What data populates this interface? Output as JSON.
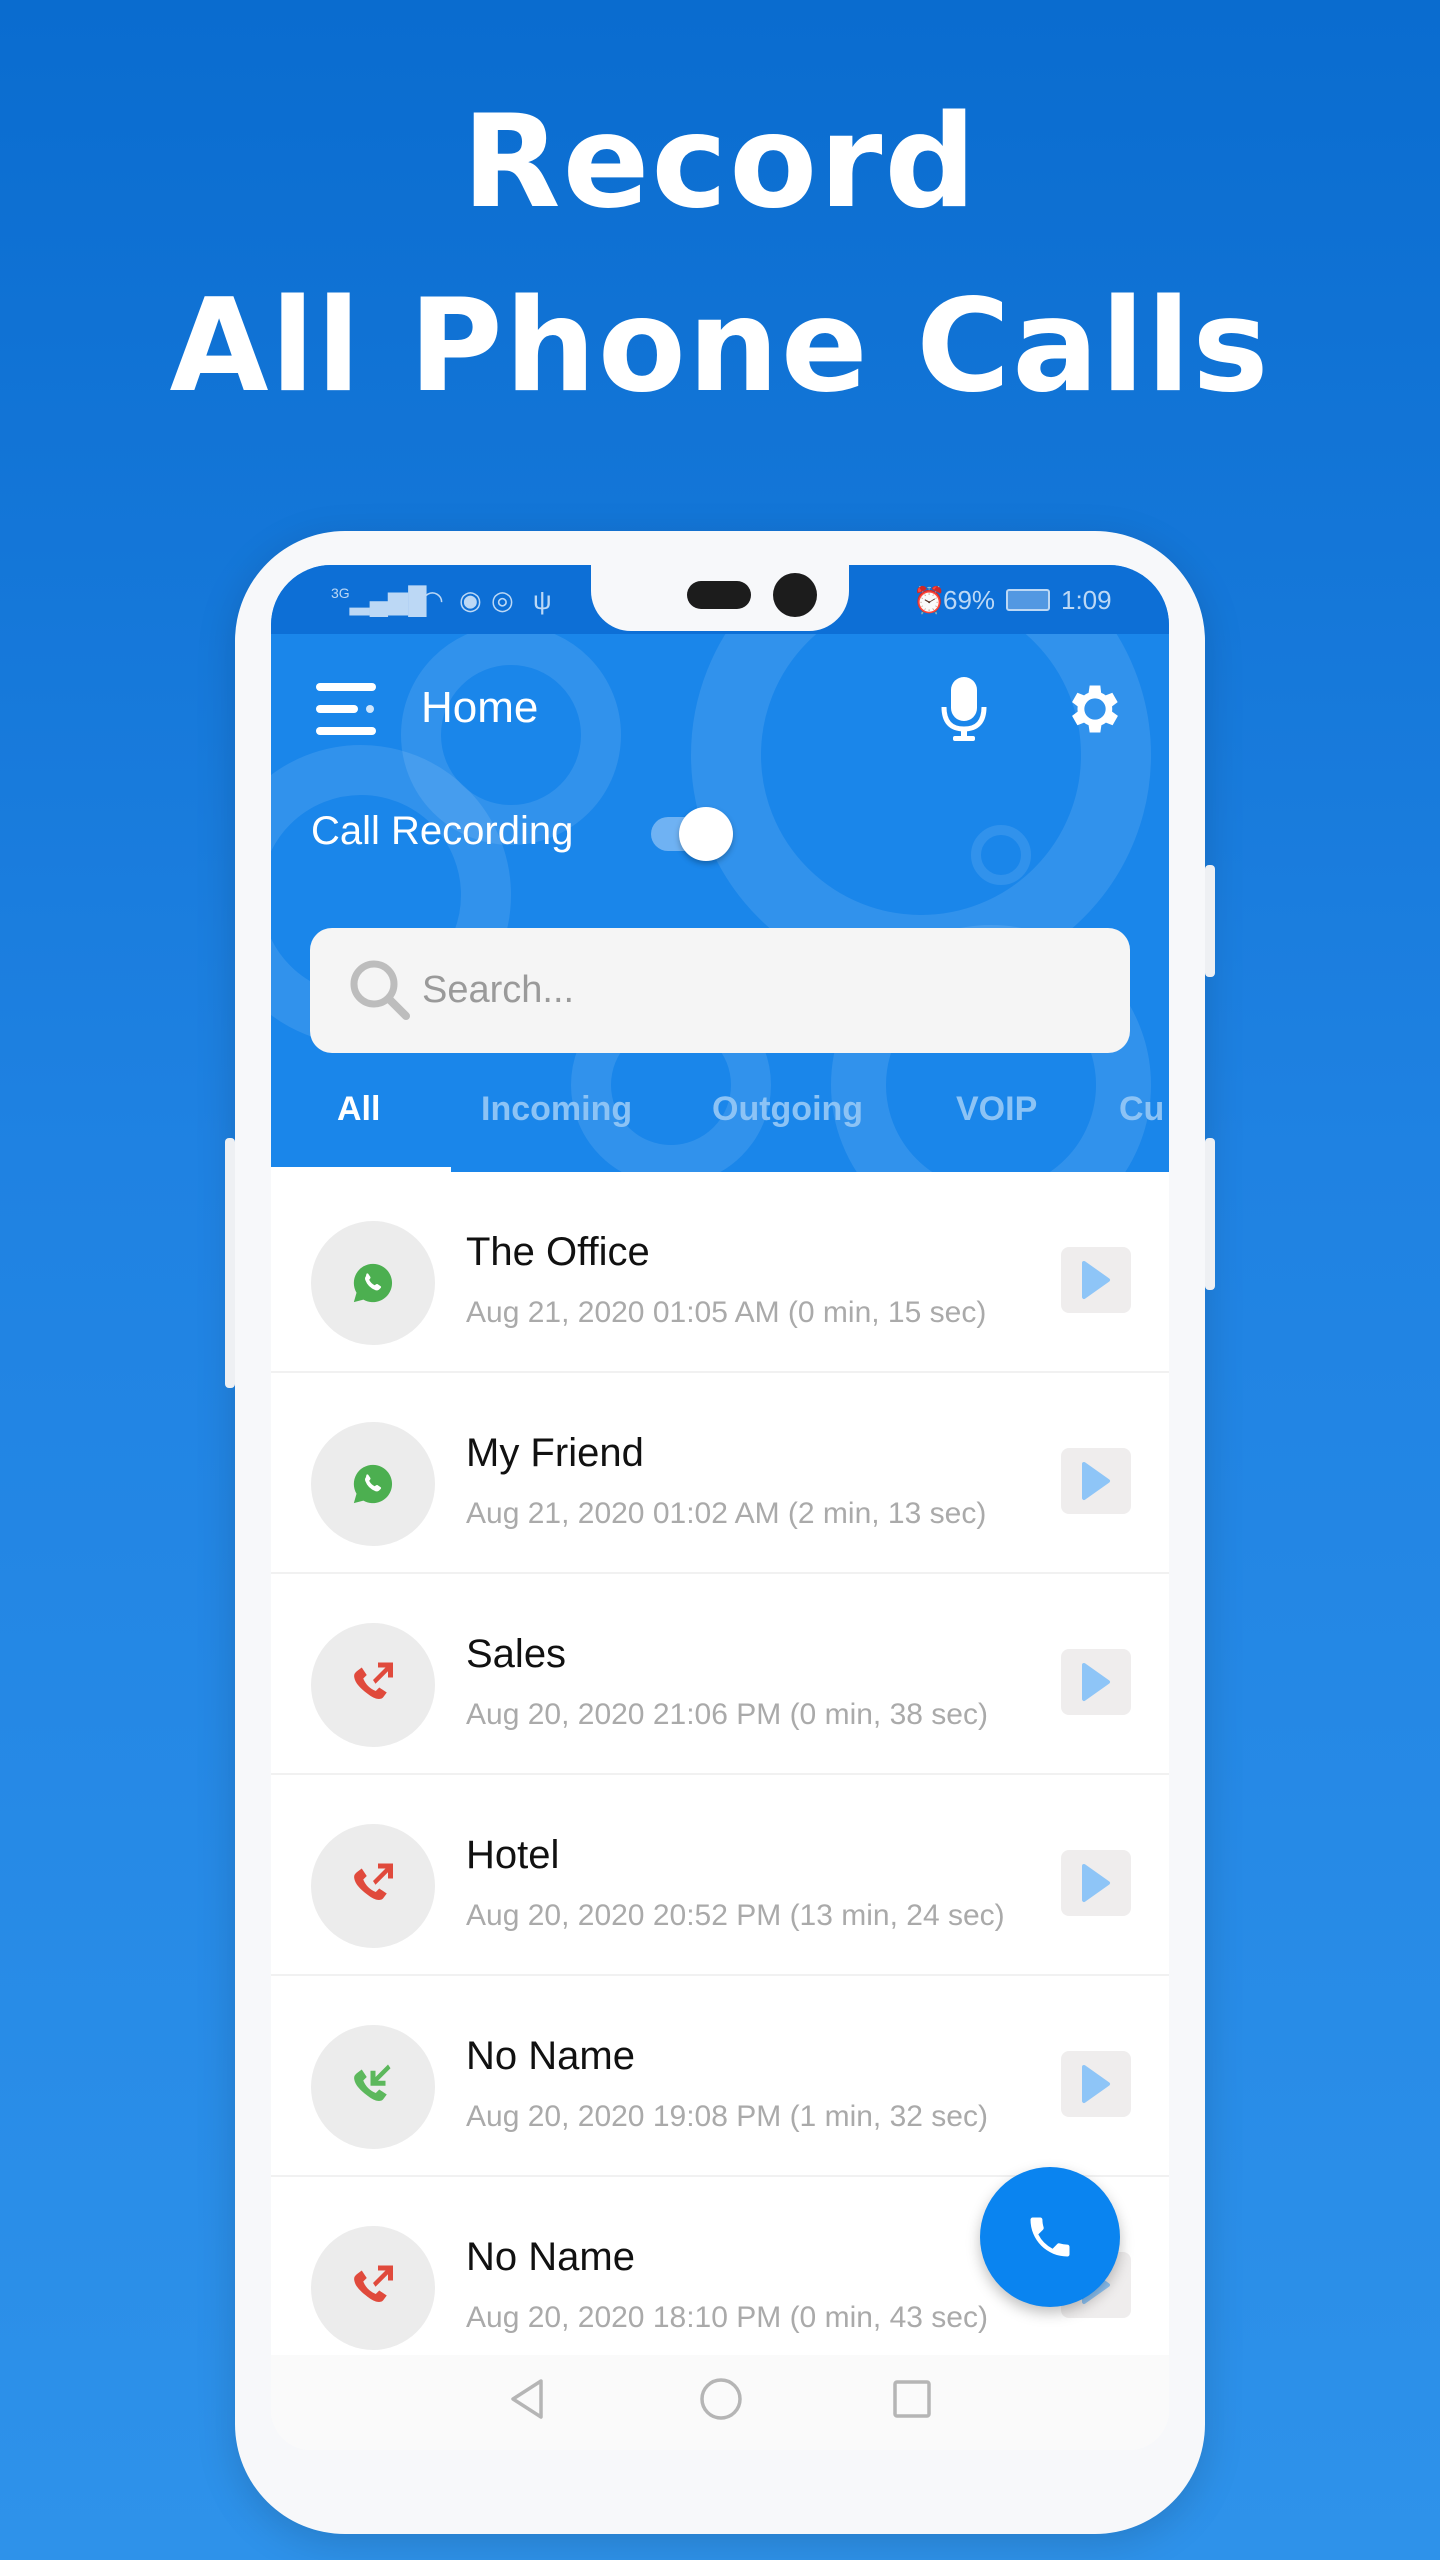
{
  "headline": {
    "line1": "Record",
    "line2": "All Phone Calls"
  },
  "status_bar": {
    "network": "3G",
    "battery": "69%",
    "time": "1:09"
  },
  "header": {
    "title": "Home",
    "toggle_label": "Call Recording",
    "toggle_on": true,
    "search_placeholder": "Search..."
  },
  "tabs": [
    {
      "label": "All",
      "active": true
    },
    {
      "label": "Incoming"
    },
    {
      "label": "Outgoing"
    },
    {
      "label": "VOIP"
    },
    {
      "label": "Cu"
    }
  ],
  "recordings": [
    {
      "name": "The Office",
      "detail": "Aug 21, 2020 01:05 AM (0 min, 15 sec)",
      "type": "whatsapp"
    },
    {
      "name": "My Friend",
      "detail": "Aug 21, 2020 01:02 AM (2 min, 13 sec)",
      "type": "whatsapp"
    },
    {
      "name": "Sales",
      "detail": "Aug 20, 2020 21:06 PM (0 min, 38 sec)",
      "type": "outgoing"
    },
    {
      "name": "Hotel",
      "detail": "Aug 20, 2020 20:52 PM (13 min, 24 sec)",
      "type": "outgoing"
    },
    {
      "name": "No Name",
      "detail": "Aug 20, 2020 19:08 PM (1 min, 32 sec)",
      "type": "incoming"
    },
    {
      "name": "No Name",
      "detail": "Aug 20, 2020 18:10 PM (0 min, 43 sec)",
      "type": "outgoing"
    }
  ],
  "colors": {
    "accent": "#1a86ea",
    "fab": "#0a84f0",
    "whatsapp": "#4caf50",
    "outgoing": "#e04a3c",
    "incoming": "#5cb85c",
    "play": "#8ec5f7"
  }
}
